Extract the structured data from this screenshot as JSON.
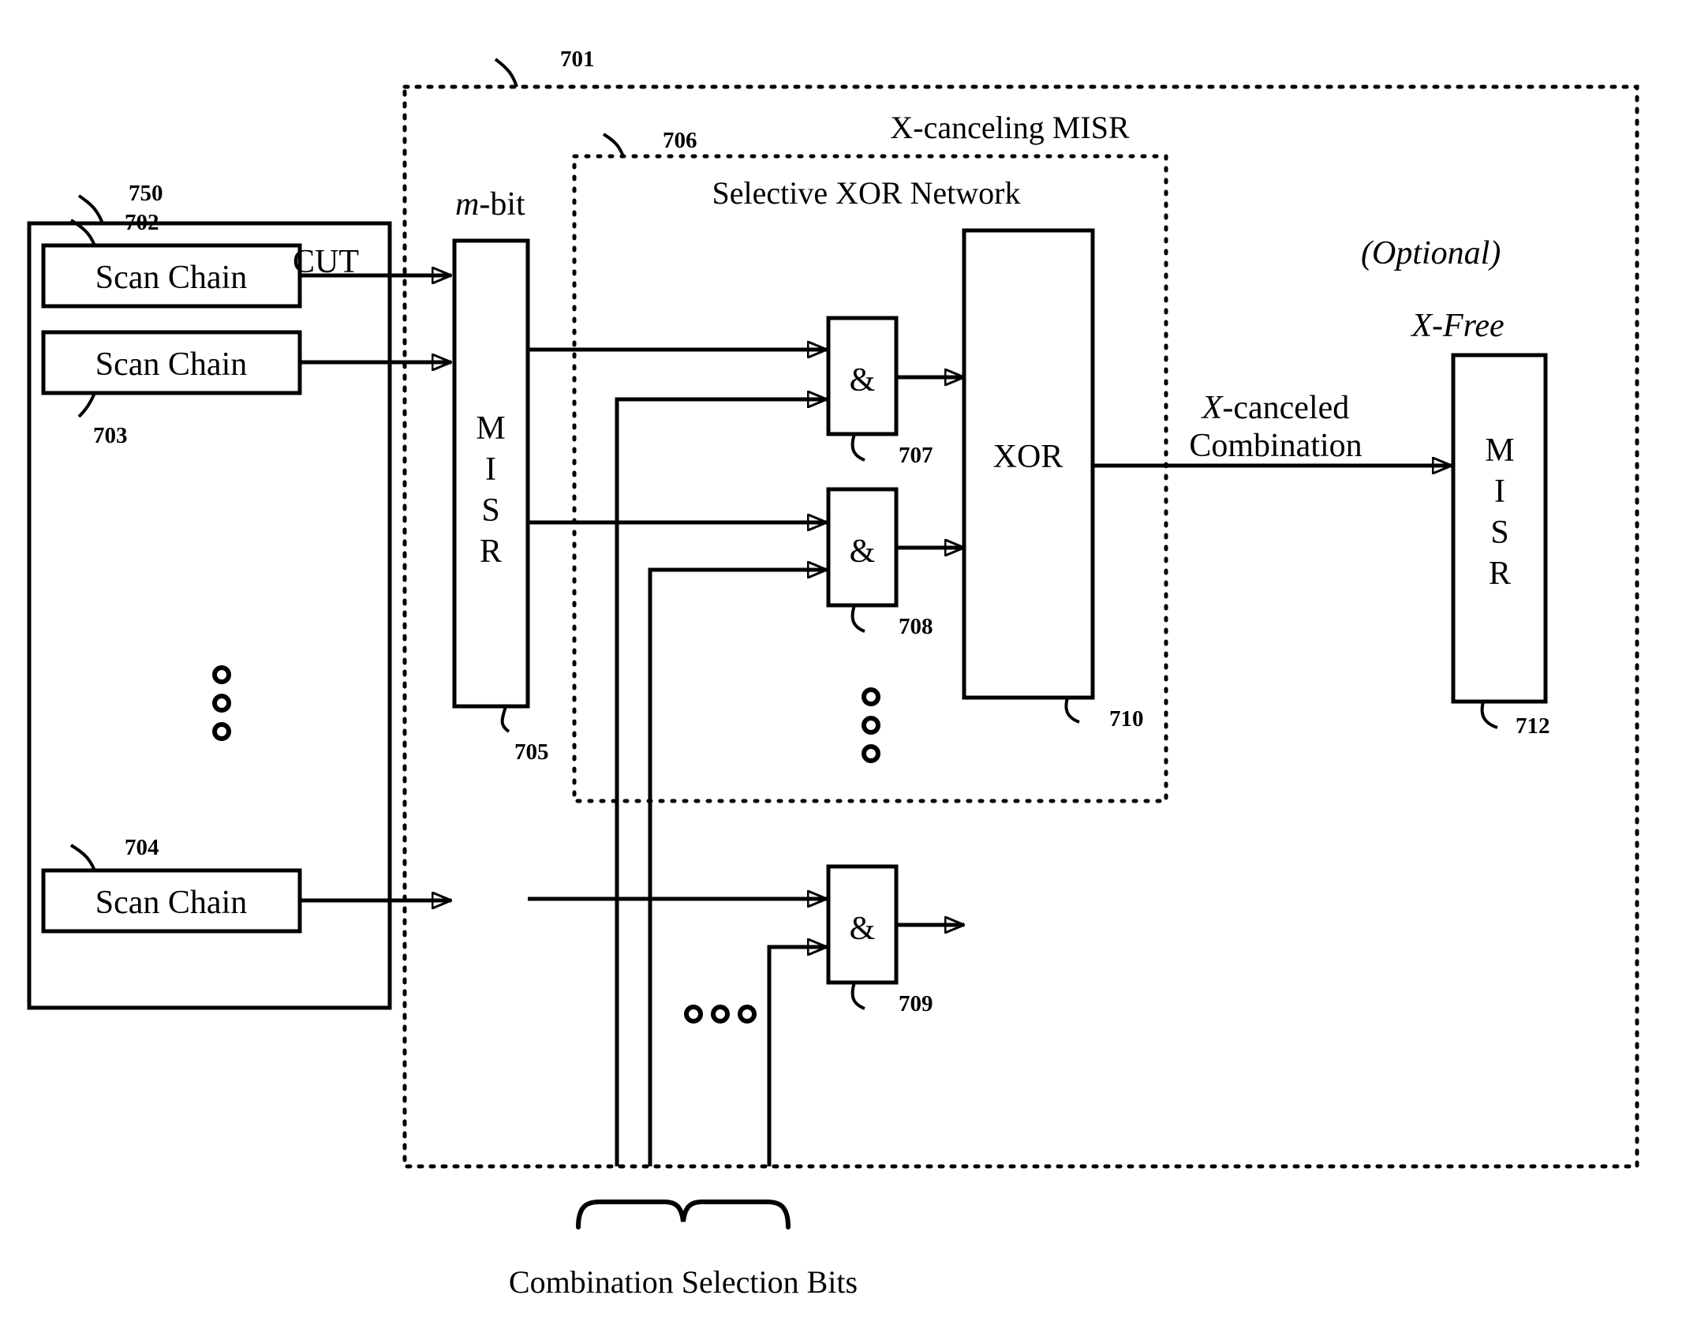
{
  "figure": {
    "outer_block_label": "X-canceling MISR",
    "outer_block_ref": "701",
    "cut_block": {
      "label": "CUT",
      "ref": "750",
      "scan_chains": [
        {
          "label": "Scan Chain",
          "ref": "702"
        },
        {
          "label": "Scan Chain",
          "ref": "703"
        },
        {
          "label": "Scan Chain",
          "ref": "704"
        }
      ],
      "vertical_ellipsis": "o o o"
    },
    "misr_input": {
      "caption": "m-bit",
      "caption_italic_part": "m",
      "caption_rest": "-bit",
      "letters": [
        "M",
        "I",
        "S",
        "R"
      ],
      "ref": "705"
    },
    "selective_xor_network": {
      "label": "Selective XOR Network",
      "ref": "706",
      "and_gates": [
        {
          "symbol": "&",
          "ref": "707"
        },
        {
          "symbol": "&",
          "ref": "708"
        },
        {
          "symbol": "&",
          "ref": "709"
        }
      ],
      "gate_ellipsis": "o o o",
      "bus_ellipsis": "o o o",
      "xor_block": {
        "label": "XOR",
        "ref": "710"
      }
    },
    "output_signal": {
      "line1": "X-canceled",
      "line1_italic_part": "X",
      "line1_rest": "-canceled",
      "line2": "Combination"
    },
    "optional_block": {
      "optional_label": "(Optional)",
      "x_free_label": "X-Free",
      "x_free_italic_part": "X",
      "x_free_rest": "-Free",
      "letters": [
        "M",
        "I",
        "S",
        "R"
      ],
      "ref": "712"
    },
    "bottom_caption": "Combination Selection Bits"
  }
}
